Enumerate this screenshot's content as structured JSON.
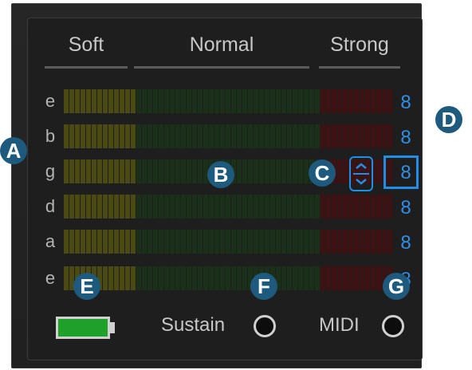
{
  "headers": {
    "soft": "Soft",
    "normal": "Normal",
    "strong": "Strong"
  },
  "strings": [
    {
      "name": "e",
      "value": "8"
    },
    {
      "name": "b",
      "value": "8"
    },
    {
      "name": "g",
      "value": "8"
    },
    {
      "name": "d",
      "value": "8"
    },
    {
      "name": "a",
      "value": "8"
    },
    {
      "name": "e",
      "value": "8"
    }
  ],
  "callouts": {
    "a": "A",
    "b": "B",
    "c": "C",
    "d": "D",
    "e": "E",
    "f": "F",
    "g": "G"
  },
  "bottom": {
    "sustain_label": "Sustain",
    "midi_label": "MIDI"
  },
  "colors": {
    "accent": "#1e8ee8",
    "battery": "#1fa02a",
    "soft_segment": "#4a4a12",
    "normal_segment": "#1a3018",
    "strong_segment": "#3e1212"
  }
}
